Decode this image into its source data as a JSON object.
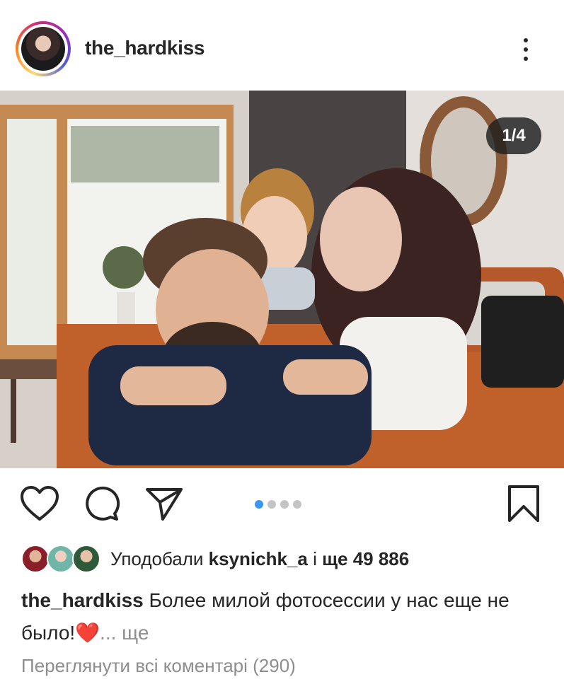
{
  "header": {
    "username": "the_hardkiss",
    "more_icon": "more-vertical-icon"
  },
  "photo": {
    "counter": "1/4"
  },
  "actions": {
    "like_icon": "heart-icon",
    "comment_icon": "comment-icon",
    "share_icon": "send-icon",
    "save_icon": "bookmark-icon",
    "carousel_total": 4,
    "carousel_active": 1
  },
  "likes": {
    "prefix": "Уподобали ",
    "user": "ksynichk_a",
    "mid": " і ",
    "count": "ще 49 886"
  },
  "caption": {
    "username": "the_hardkiss",
    "text": " Более милой фотосессии у нас еще не было!",
    "emoji": "❤️",
    "more": "... ще"
  },
  "comments": {
    "view_all": "Переглянути всі коментарі (290)"
  },
  "colors": {
    "accent": "#3897f0",
    "text": "#262626",
    "muted": "#8e8e8e"
  }
}
